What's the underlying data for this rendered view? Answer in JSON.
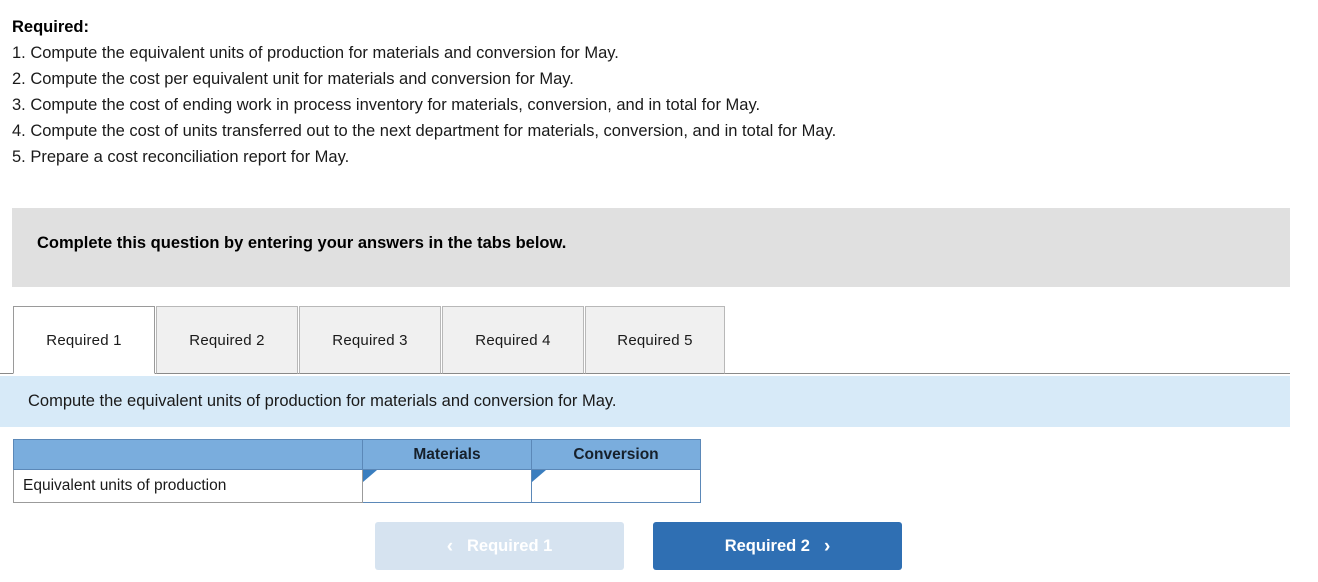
{
  "requirements": {
    "title": "Required:",
    "items": [
      "1. Compute the equivalent units of production for materials and conversion for May.",
      "2. Compute the cost per equivalent unit for materials and conversion for May.",
      "3. Compute the cost of ending work in process inventory for materials, conversion, and in total for May.",
      "4. Compute the cost of units transferred out to the next department for materials, conversion, and in total for May.",
      "5. Prepare a cost reconciliation report for May."
    ]
  },
  "banner": {
    "text": "Complete this question by entering your answers in the tabs below."
  },
  "tabs": [
    {
      "label": "Required 1",
      "active": true
    },
    {
      "label": "Required 2",
      "active": false
    },
    {
      "label": "Required 3",
      "active": false
    },
    {
      "label": "Required 4",
      "active": false
    },
    {
      "label": "Required 5",
      "active": false
    }
  ],
  "question_bar": {
    "text": "Compute the equivalent units of production for materials and conversion for May."
  },
  "answer_table": {
    "headers": [
      "",
      "Materials",
      "Conversion"
    ],
    "rows": [
      {
        "label": "Equivalent units of production",
        "materials_value": "",
        "conversion_value": ""
      }
    ]
  },
  "navigation": {
    "prev_label": "Required 1",
    "next_label": "Required 2",
    "prev_icon": "chevron-left-icon",
    "next_icon": "chevron-right-icon",
    "prev_chevron": "‹",
    "next_chevron": "›"
  },
  "colors": {
    "header_blue": "#7aaddd",
    "question_bar_blue": "#d7eaf8",
    "banner_gray": "#e0e0e0",
    "next_button_blue": "#2f6fb3",
    "prev_button_blue": "#d6e3f0"
  }
}
